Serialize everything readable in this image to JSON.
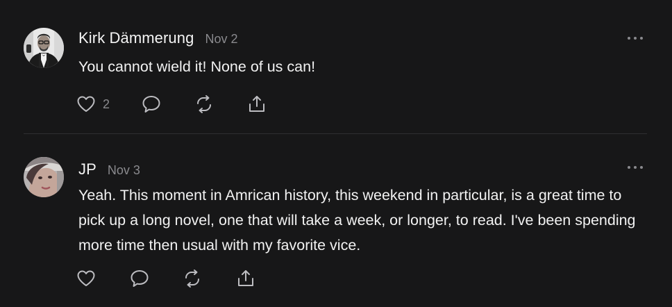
{
  "colors": {
    "background": "#171718",
    "text": "#f2f2f2",
    "muted": "#8a8a8e",
    "icon": "#bdbdc1",
    "divider": "#2f2f31"
  },
  "comments": [
    {
      "author": "Kirk Dämmerung",
      "date": "Nov 2",
      "text": "You cannot wield it! None of us can!",
      "like_count": "2",
      "avatar_icon": "avatar-man-suspenders",
      "actions": [
        "heart-icon",
        "comment-icon",
        "repost-icon",
        "share-icon"
      ]
    },
    {
      "author": "JP",
      "date": "Nov 3",
      "text": "Yeah. This moment in Amrican history, this weekend in particular, is a great time to pick up a long novel, one that will take a week, or longer, to read. I've been spending more time then usual with my favorite vice.",
      "like_count": "",
      "avatar_icon": "avatar-woman-portrait",
      "actions": [
        "heart-icon",
        "comment-icon",
        "repost-icon",
        "share-icon"
      ]
    }
  ]
}
